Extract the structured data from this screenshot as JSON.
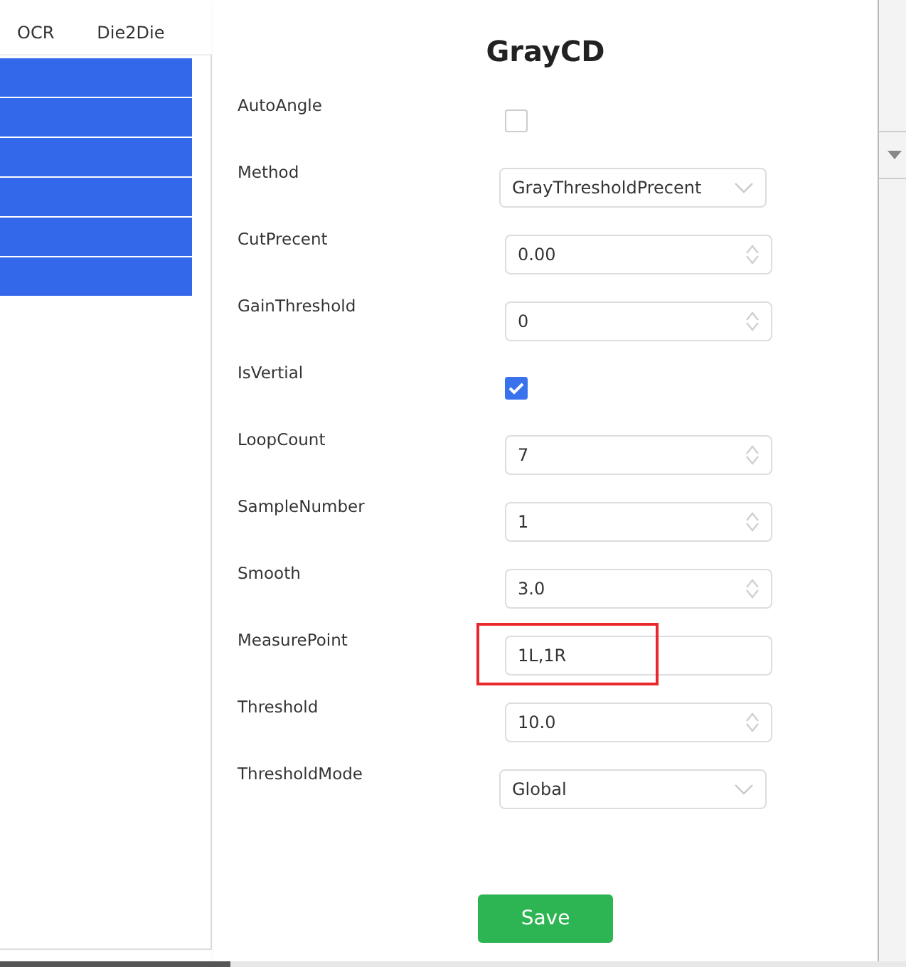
{
  "left_panel": {
    "tabs": [
      {
        "label": "OCR"
      },
      {
        "label": "Die2Die"
      }
    ],
    "rows": [
      {
        "selected": true
      },
      {
        "selected": true
      },
      {
        "selected": true
      },
      {
        "selected": true
      },
      {
        "selected": true
      },
      {
        "selected": true
      }
    ]
  },
  "dialog": {
    "title": "GrayCD",
    "fields": [
      {
        "label": "AutoAngle",
        "kind": "checkbox",
        "checked": false
      },
      {
        "label": "Method",
        "kind": "select",
        "value": "GrayThresholdPrecent"
      },
      {
        "label": "CutPrecent",
        "kind": "number",
        "value": "0.00"
      },
      {
        "label": "GainThreshold",
        "kind": "number",
        "value": "0"
      },
      {
        "label": "IsVertial",
        "kind": "checkbox",
        "checked": true
      },
      {
        "label": "LoopCount",
        "kind": "number",
        "value": "7"
      },
      {
        "label": "SampleNumber",
        "kind": "number",
        "value": "1"
      },
      {
        "label": "Smooth",
        "kind": "number",
        "value": "3.0"
      },
      {
        "label": "MeasurePoint",
        "kind": "text",
        "value": "1L,1R",
        "highlighted": true
      },
      {
        "label": "Threshold",
        "kind": "number",
        "value": "10.0"
      },
      {
        "label": "ThresholdMode",
        "kind": "select",
        "value": "Global"
      }
    ],
    "save_button": "Save"
  }
}
